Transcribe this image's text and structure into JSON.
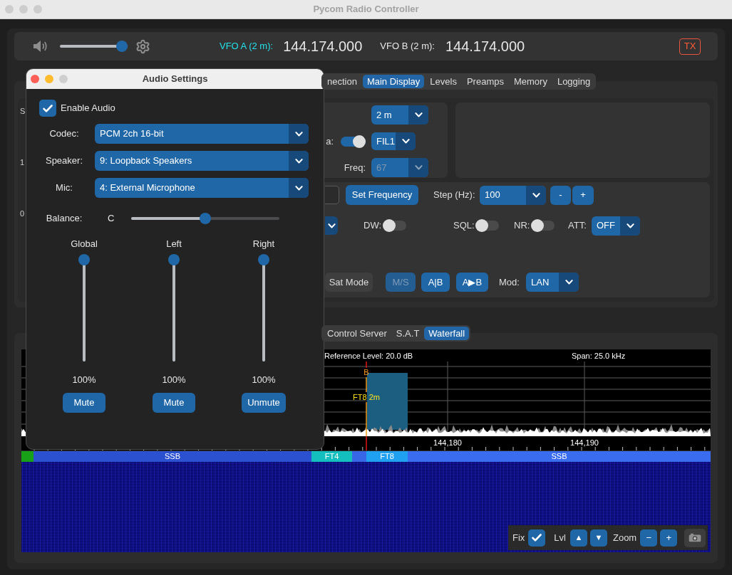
{
  "window": {
    "title": "Pycom Radio Controller"
  },
  "top_bar": {
    "volume": {
      "level": 1
    },
    "vfos": [
      {
        "label": "VFO A (2 m):",
        "frequency": "144.174.000",
        "selected": true
      },
      {
        "label": "VFO B (2 m):",
        "frequency": "144.174.000",
        "selected": false
      }
    ],
    "tx_button": "TX"
  },
  "main_tabs": [
    {
      "label": "nection",
      "selected": false
    },
    {
      "label": "Main Display",
      "selected": true
    },
    {
      "label": "Levels",
      "selected": false
    },
    {
      "label": "Preamps",
      "selected": false
    },
    {
      "label": "Memory",
      "selected": false
    },
    {
      "label": "Logging",
      "selected": false
    }
  ],
  "left_panel": {
    "labels": [
      "S",
      "1",
      "0"
    ]
  },
  "radio_group": {
    "band": {
      "value": "2 m"
    },
    "data": {
      "label": "a:",
      "on": true
    },
    "filter": {
      "value": "FIL1"
    },
    "tone": {
      "label": "Freq:",
      "value": "67",
      "disabled": true
    }
  },
  "tuning": {
    "set_button": "Set Frequency",
    "step": {
      "label": "Step (Hz):",
      "value": "100"
    },
    "step_buttons": [
      "-",
      "+"
    ]
  },
  "switches": [
    {
      "label": "DW:",
      "on": false
    },
    {
      "label": "SQL:",
      "on": false
    },
    {
      "label": "NR:",
      "on": false
    }
  ],
  "attenuator": {
    "label": "ATT:",
    "value": "OFF"
  },
  "vfo_controls": {
    "sat_mode": {
      "label": "Sat Mode",
      "on": false
    },
    "buttons": [
      {
        "label": "M/S",
        "disabled": true
      },
      {
        "label": "A|B",
        "disabled": false
      },
      {
        "label": "A▶B",
        "disabled": false
      }
    ],
    "mod": {
      "label": "Mod:",
      "value": "LAN"
    }
  },
  "bottom_tabs": [
    {
      "label": "Control Server",
      "selected": false
    },
    {
      "label": "S.A.T",
      "selected": false
    },
    {
      "label": "Waterfall",
      "selected": true
    }
  ],
  "spectrum": {
    "reference_level": "Reference Level: 20.0 dB",
    "span": "Span: 25.0 kHz",
    "marker": "B",
    "signal_label": "FT8 2m",
    "axis_labels": [
      "144,180",
      "144,190"
    ]
  },
  "bands": [
    {
      "color": "#19a019"
    },
    {
      "label": "SSB",
      "color": "#2b50d0"
    },
    {
      "label": "FT4",
      "color": "#14bebe"
    },
    {
      "color": "#3766e6"
    },
    {
      "label": "FT8",
      "color": "#1fa0f0"
    },
    {
      "label": "SSB",
      "color": "#3a6cf0"
    }
  ],
  "waterfall_toolbar": {
    "fix": {
      "label": "Fix",
      "checked": true
    },
    "level_label": "Lvl",
    "level_buttons": [
      "▲",
      "▼"
    ],
    "zoom_label": "Zoom",
    "zoom_buttons": [
      "−",
      "+"
    ]
  },
  "audio_dialog": {
    "title": "Audio Settings",
    "enable_audio": {
      "label": "Enable Audio",
      "checked": true
    },
    "devices": [
      {
        "label": "Codec:",
        "value": "PCM 2ch 16-bit"
      },
      {
        "label": "Speaker:",
        "value": "9: Loopback Speakers"
      },
      {
        "label": "Mic:",
        "value": "4: External Microphone"
      }
    ],
    "balance": {
      "label": "Balance:",
      "reading": "C",
      "level": 0.5
    },
    "channels": [
      {
        "name": "Global",
        "level": 1,
        "reading": "100%",
        "button": "Mute"
      },
      {
        "name": "Left",
        "level": 1,
        "reading": "100%",
        "button": "Mute"
      },
      {
        "name": "Right",
        "level": 1,
        "reading": "100%",
        "button": "Unmute"
      }
    ]
  }
}
